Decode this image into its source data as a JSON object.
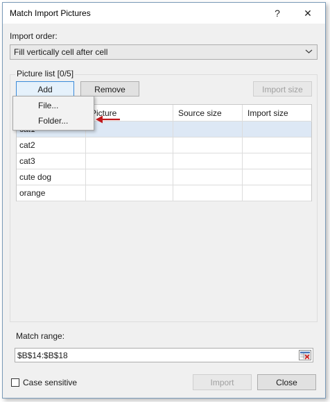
{
  "window": {
    "title": "Match Import Pictures",
    "help_glyph": "?",
    "close_glyph": "✕"
  },
  "import_order": {
    "label": "Import order:",
    "selected": "Fill vertically cell after cell"
  },
  "picture_list": {
    "legend": "Picture list [0/5]",
    "add_label": "Add",
    "remove_label": "Remove",
    "import_size_label": "Import size",
    "columns": [
      "",
      "Picture",
      "Source size",
      "Import size"
    ],
    "rows": [
      {
        "name": "cat1",
        "picture": "",
        "source_size": "",
        "import_size": "",
        "selected": true
      },
      {
        "name": "cat2",
        "picture": "",
        "source_size": "",
        "import_size": "",
        "selected": false
      },
      {
        "name": "cat3",
        "picture": "",
        "source_size": "",
        "import_size": "",
        "selected": false
      },
      {
        "name": "cute dog",
        "picture": "",
        "source_size": "",
        "import_size": "",
        "selected": false
      },
      {
        "name": "orange",
        "picture": "",
        "source_size": "",
        "import_size": "",
        "selected": false
      }
    ]
  },
  "add_menu": {
    "items": [
      "File...",
      "Folder..."
    ]
  },
  "match_range": {
    "label": "Match range:",
    "value": "$B$14:$B$18"
  },
  "case_sensitive": {
    "label": "Case sensitive",
    "checked": false
  },
  "footer": {
    "import_label": "Import",
    "close_label": "Close"
  },
  "colors": {
    "accent": "#3a8ad9",
    "selected_row": "#dde8f5",
    "arrow": "#c0181c"
  }
}
